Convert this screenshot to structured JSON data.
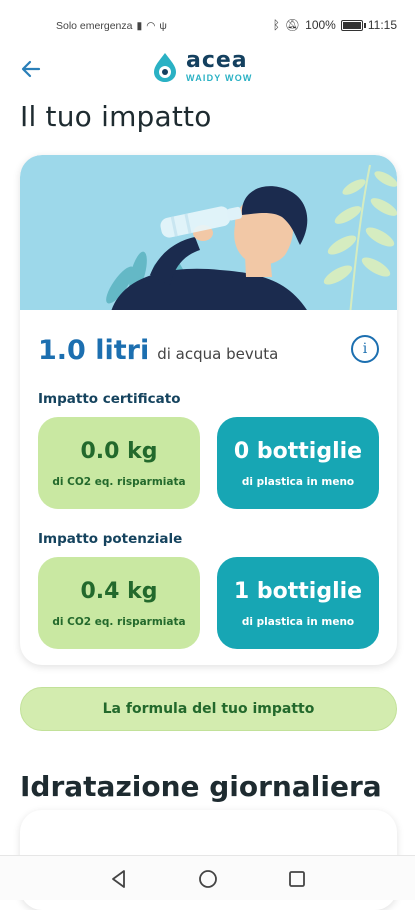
{
  "status": {
    "carrier": "Solo emergenza",
    "battery": "100%",
    "time": "11:15"
  },
  "header": {
    "back_icon": "back-arrow-icon",
    "logo_name": "acea",
    "logo_sub": "WAIDY WOW"
  },
  "page": {
    "title": "Il tuo impatto"
  },
  "impact": {
    "liters_value": "1.0 litri",
    "liters_caption": "di acqua bevuta",
    "info_icon": "info-icon",
    "certified": {
      "label": "Impatto certificato",
      "co2_value": "0.0 kg",
      "co2_caption": "di CO2 eq. risparmiata",
      "bottles_value": "0 bottiglie",
      "bottles_caption": "di plastica in meno"
    },
    "potential": {
      "label": "Impatto potenziale",
      "co2_value": "0.4 kg",
      "co2_caption": "di CO2 eq. risparmiata",
      "bottles_value": "1 bottiglie",
      "bottles_caption": "di plastica in meno"
    }
  },
  "formula_button": "La formula del tuo impatto",
  "hydration": {
    "title": "Idratazione giornaliera"
  },
  "colors": {
    "accent": "#1c6fb0",
    "green_tile": "#c9e8a2",
    "teal_tile": "#17a6b4",
    "illustration_bg": "#9dd8ea"
  }
}
